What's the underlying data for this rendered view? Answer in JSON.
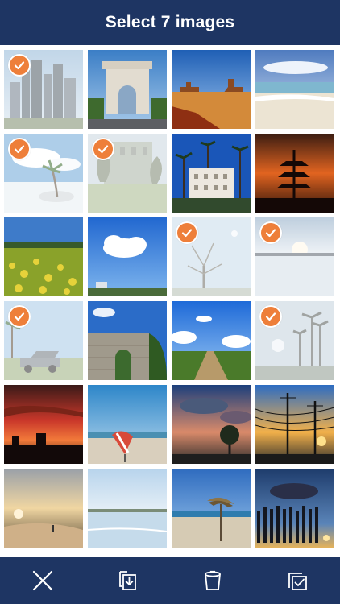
{
  "header": {
    "title": "Select 7 images"
  },
  "toolbar": {
    "items": [
      {
        "icon": "close-icon"
      },
      {
        "icon": "save-to-device-icon"
      },
      {
        "icon": "trash-icon"
      },
      {
        "icon": "select-all-icon"
      }
    ]
  },
  "colors": {
    "bar": "#1e3563",
    "check": "#ee7f3a"
  },
  "photos": [
    {
      "subject": "city-skyline",
      "selected": true
    },
    {
      "subject": "arc-de-triomphe",
      "selected": false
    },
    {
      "subject": "desert-mesa",
      "selected": false
    },
    {
      "subject": "beach-shore",
      "selected": false
    },
    {
      "subject": "palm-island",
      "selected": true
    },
    {
      "subject": "park-building",
      "selected": true
    },
    {
      "subject": "palms-hotel",
      "selected": false
    },
    {
      "subject": "pagoda-sunset",
      "selected": false
    },
    {
      "subject": "rapeseed-field",
      "selected": false
    },
    {
      "subject": "cloud-sky",
      "selected": false
    },
    {
      "subject": "misty-tree",
      "selected": true
    },
    {
      "subject": "snow-field-sunrise",
      "selected": true
    },
    {
      "subject": "old-car-palms",
      "selected": true
    },
    {
      "subject": "stone-ruin-gate",
      "selected": false
    },
    {
      "subject": "country-road",
      "selected": false
    },
    {
      "subject": "misty-palms",
      "selected": true
    },
    {
      "subject": "red-sunset",
      "selected": false
    },
    {
      "subject": "beach-umbrella",
      "selected": false
    },
    {
      "subject": "tree-dusk",
      "selected": false
    },
    {
      "subject": "power-lines-sunset",
      "selected": false
    },
    {
      "subject": "golden-beach",
      "selected": false
    },
    {
      "subject": "calm-shore",
      "selected": false
    },
    {
      "subject": "straw-umbrella",
      "selected": false
    },
    {
      "subject": "fence-sunset",
      "selected": false
    }
  ]
}
